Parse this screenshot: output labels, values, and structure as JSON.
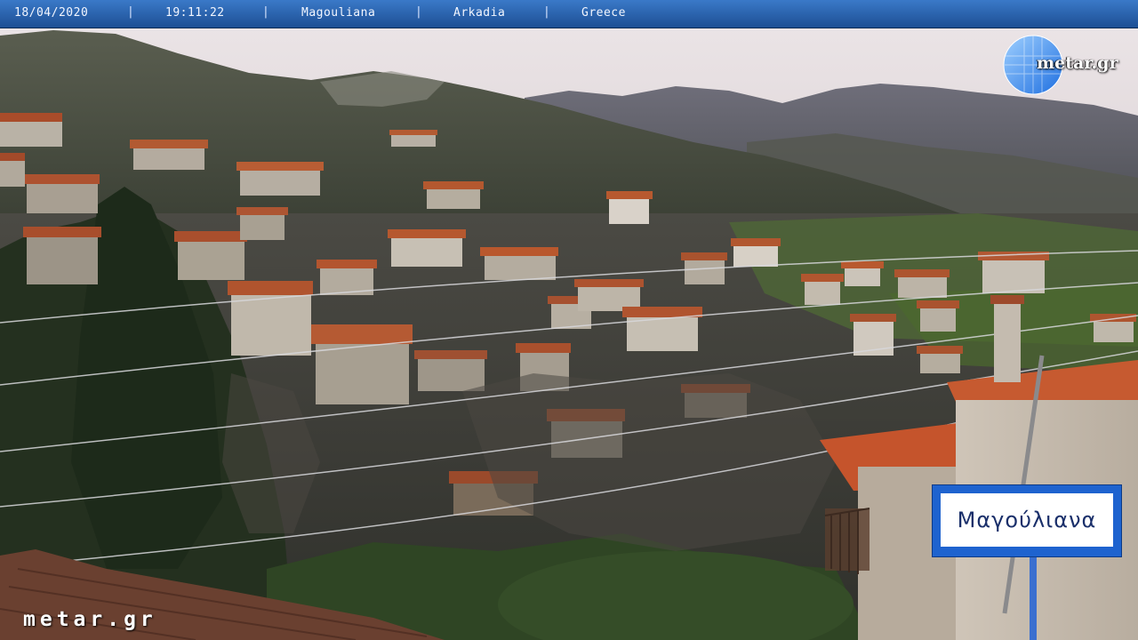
{
  "header": {
    "date": "18/04/2020",
    "time": "19:11:22",
    "location": "Magouliana",
    "region": "Arkadia",
    "country": "Greece",
    "separator": "|"
  },
  "logo": {
    "text": "metar.gr",
    "icon": "globe-icon"
  },
  "watermark": "metar.gr",
  "sign": {
    "text": "Μαγούλιανα"
  },
  "colors": {
    "header_bar": "#2a63b0",
    "sign_blue": "#1e63cf",
    "roof_terracotta": "#b5532d",
    "sky": "#e4dcdf"
  }
}
